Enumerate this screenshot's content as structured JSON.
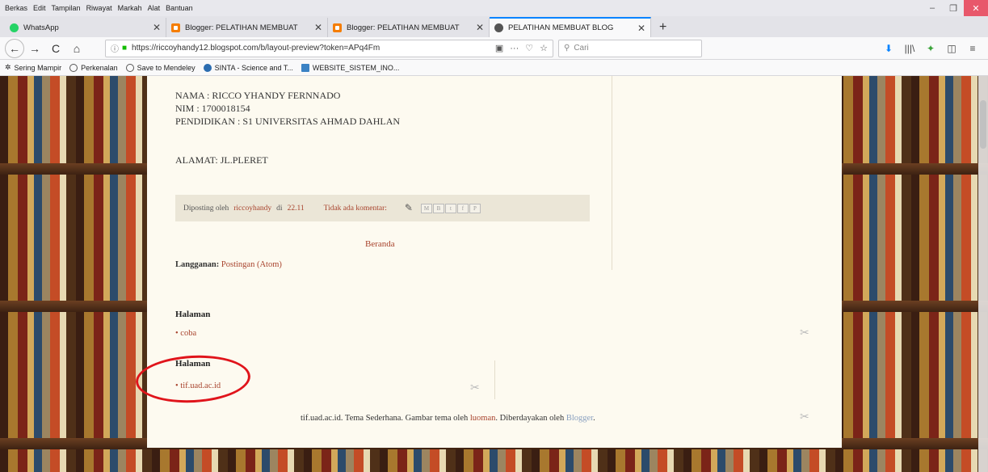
{
  "menu": [
    "Berkas",
    "Edit",
    "Tampilan",
    "Riwayat",
    "Markah",
    "Alat",
    "Bantuan"
  ],
  "window_controls": {
    "minimize": "–",
    "restore": "❐",
    "close": "✕"
  },
  "tabs": [
    {
      "label": "WhatsApp",
      "icon": "whatsapp-icon"
    },
    {
      "label": "Blogger: PELATIHAN MEMBUAT",
      "icon": "blogger-icon"
    },
    {
      "label": "Blogger: PELATIHAN MEMBUAT",
      "icon": "blogger-icon"
    },
    {
      "label": "PELATIHAN MEMBUAT BLOG",
      "icon": "globe-icon"
    }
  ],
  "tab_close": "✕",
  "new_tab": "+",
  "nav": {
    "back": "←",
    "forward": "→",
    "reload": "C",
    "home": "⌂",
    "url": "https://riccoyhandy12.blogspot.com/b/layout-preview?token=APq4Fm",
    "search_placeholder": "Cari",
    "url_actions": [
      "▣",
      "···",
      "♡",
      "☆"
    ]
  },
  "toolbar_icons": [
    "⬇",
    "|||\\",
    "✦",
    "◫",
    "≡"
  ],
  "bookmarks": [
    "Sering Mampir",
    "Perkenalan",
    "Save to Mendeley",
    "SINTA - Science and T...",
    "WEBSITE_SISTEM_INO..."
  ],
  "post": {
    "lines": [
      "NAMA : RICCO YHANDY FERNNADO",
      "NIM : 1700018154",
      "PENDIDIKAN : S1 UNIVERSITAS AHMAD DAHLAN"
    ],
    "address": "ALAMAT: JL.PLERET",
    "footer": {
      "posted_by": "Diposting oleh",
      "author": "riccoyhandy",
      "at": "di",
      "time": "22.11",
      "comments": "Tidak ada komentar:",
      "share": [
        "M",
        "B",
        "t",
        "f",
        "P"
      ]
    }
  },
  "home_link": "Beranda",
  "subscribe": {
    "label": "Langganan:",
    "link": "Postingan (Atom)"
  },
  "widgets": [
    {
      "title": "Halaman",
      "item": "• coba"
    },
    {
      "title": "Halaman",
      "item": "• tif.uad.ac.id"
    }
  ],
  "footer": {
    "text1": "tif.uad.ac.id. Tema Sederhana. Gambar tema oleh",
    "link1": "luoman",
    "text2": ". Diberdayakan oleh",
    "link2": "Blogger",
    "text3": "."
  },
  "colors": {
    "accent": "#0a84ff",
    "link": "#a8432d",
    "annotation": "#e0141b"
  }
}
